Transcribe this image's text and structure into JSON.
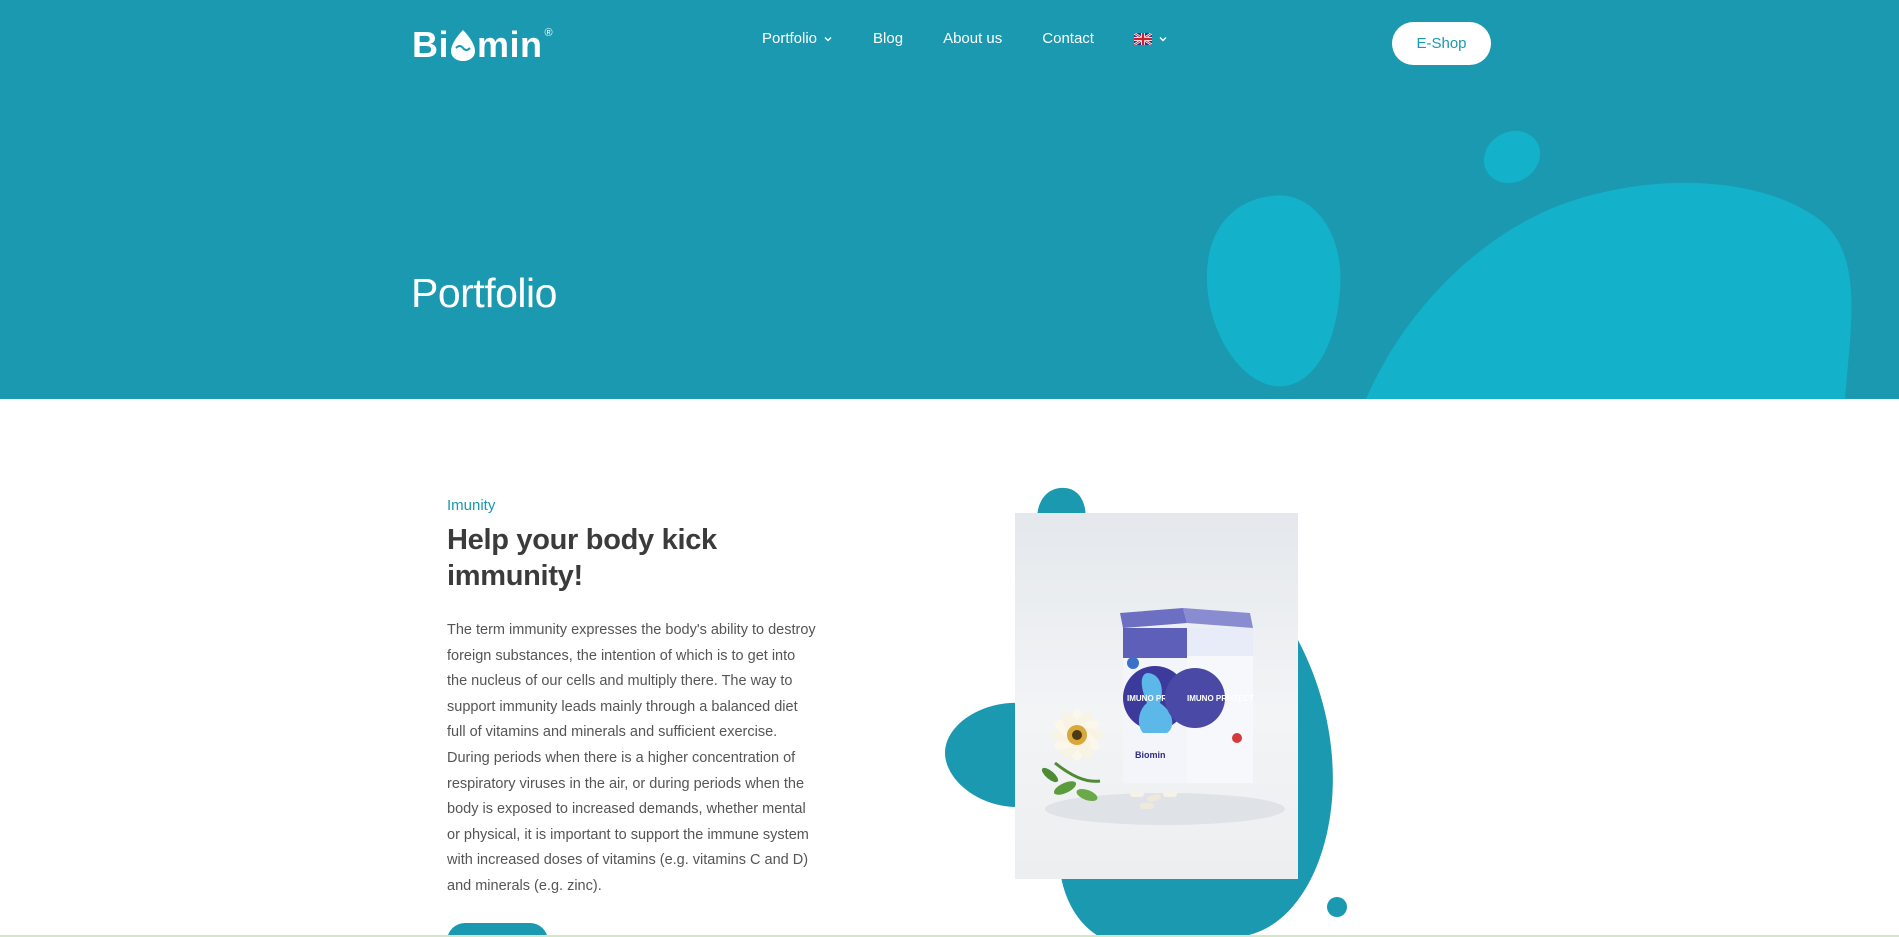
{
  "header": {
    "logo_text": "Bi",
    "logo_text_2": "min",
    "logo_mark": "®",
    "nav": [
      {
        "label": "Portfolio",
        "has_dropdown": true
      },
      {
        "label": "Blog",
        "has_dropdown": false
      },
      {
        "label": "About us",
        "has_dropdown": false
      },
      {
        "label": "Contact",
        "has_dropdown": false
      }
    ],
    "language_icon": "uk-flag-icon",
    "eshop_label": "E-Shop"
  },
  "hero": {
    "title": "Portfolio"
  },
  "section": {
    "eyebrow": "Imunity",
    "heading": "Help your body kick immunity!",
    "body": "The term immunity expresses the body's ability to destroy foreign substances, the intention of which is to get into the nucleus of our cells and multiply there. The way to support immunity leads mainly through a balanced diet full of vitamins and minerals and sufficient exercise. During periods when there is a higher concentration of respiratory viruses in the air, or during periods when the body is exposed to increased demands, whether mental or physical, it is important to support the immune system with increased doses of vitamins (e.g. vitamins C and D) and minerals (e.g. zinc).",
    "product": {
      "box_text_left": "IMUNO PROTECT",
      "box_text_right": "IMUNO PROTECT",
      "box_brand": "Biomin"
    }
  },
  "colors": {
    "brand_teal": "#1a99b0",
    "blob_cyan": "#14b1ca",
    "text_dark": "#3b3b3b",
    "text_body": "#555555"
  }
}
